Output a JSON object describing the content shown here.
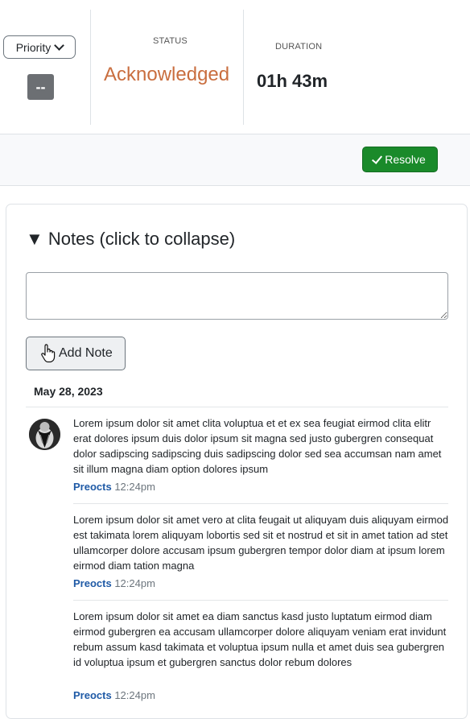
{
  "header": {
    "priority_label": "Priority",
    "priority_value": "--",
    "status_label": "STATUS",
    "status_value": "Acknowledged",
    "duration_label": "DURATION",
    "duration_value": "01h 43m"
  },
  "actions": {
    "resolve_label": "Resolve"
  },
  "notes": {
    "heading": "▼ Notes (click to collapse)",
    "input_value": "",
    "add_label": "Add Note",
    "date": "May 28, 2023",
    "entries": [
      {
        "text": "Lorem ipsum dolor sit amet clita voluptua et et ex sea feugiat eirmod clita elitr erat dolores ipsum duis dolor ipsum sit magna sed justo gubergren consequat dolor sadipscing sadipscing duis sadipscing dolor sed sea accumsan nam amet sit illum magna diam option dolores ipsum",
        "author": "Preocts",
        "time": "12:24pm"
      },
      {
        "text": "Lorem ipsum dolor sit amet vero at clita feugait ut aliquyam duis aliquyam eirmod est takimata lorem aliquyam lobortis sed sit et nostrud et sit in amet tation ad stet ullamcorper dolore accusam ipsum gubergren tempor dolor diam at ipsum lorem eirmod diam tation magna",
        "author": "Preocts",
        "time": "12:24pm"
      },
      {
        "text": "Lorem ipsum dolor sit amet ea diam sanctus kasd justo luptatum eirmod diam eirmod gubergren ea accusam ullamcorper dolore aliquyam veniam erat invidunt rebum assum kasd takimata et voluptua ipsum nulla et amet duis sea gubergren id voluptua ipsum et gubergren sanctus dolor rebum dolores",
        "author": "Preocts",
        "time": "12:24pm"
      }
    ]
  },
  "colors": {
    "status": "#c96e3f",
    "resolve": "#1a8a2a",
    "author": "#1f5aa6"
  },
  "icons": [
    "chevron-down-icon",
    "check-icon",
    "hand-cursor-icon",
    "avatar-image"
  ]
}
